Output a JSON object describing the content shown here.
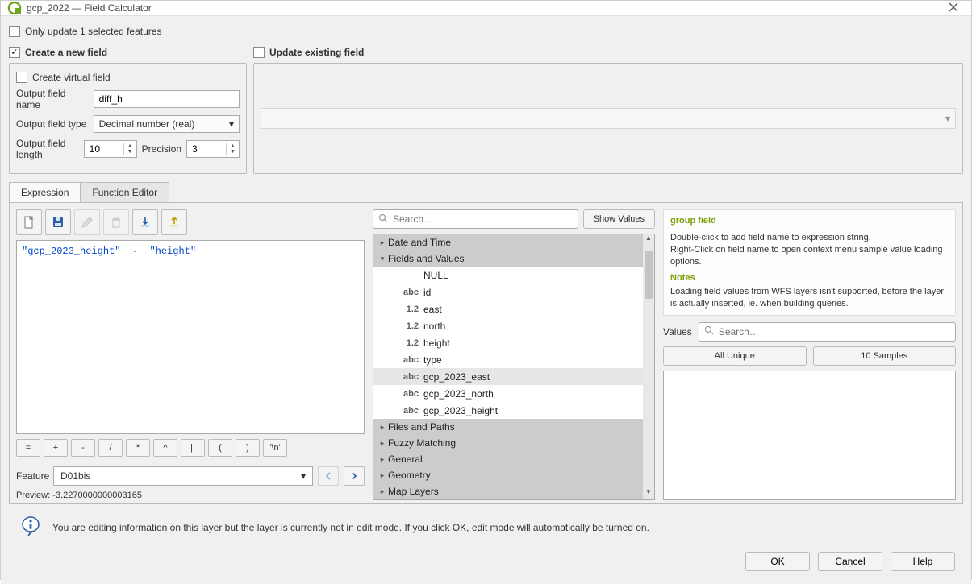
{
  "window": {
    "title": "gcp_2022 — Field Calculator"
  },
  "top": {
    "only_update_label": "Only update 1 selected features",
    "create_new_label": "Create a new field",
    "update_existing_label": "Update existing field"
  },
  "newfield": {
    "virtual_label": "Create virtual field",
    "name_label": "Output field name",
    "name_value": "diff_h",
    "type_label": "Output field type",
    "type_value": "Decimal number (real)",
    "length_label": "Output field length",
    "length_value": "10",
    "precision_label": "Precision",
    "precision_value": "3"
  },
  "tabs": {
    "expression": "Expression",
    "function_editor": "Function Editor"
  },
  "editor": {
    "token_left": "\"gcp_2023_height\"",
    "token_op": "  -  ",
    "token_right": "\"height\""
  },
  "operators": [
    "=",
    "+",
    "-",
    "/",
    "*",
    "^",
    "||",
    "(",
    ")",
    "'\\n'"
  ],
  "feature": {
    "label": "Feature",
    "value": "D01bis",
    "preview_label": "Preview:",
    "preview_value": "-3.2270000000003165"
  },
  "search": {
    "placeholder": "Search…"
  },
  "show_values_btn": "Show Values",
  "tree": {
    "groups_before": [
      "Date and Time"
    ],
    "fields_group": "Fields and Values",
    "fields": [
      {
        "type": "",
        "name": "NULL"
      },
      {
        "type": "abc",
        "name": "id"
      },
      {
        "type": "1.2",
        "name": "east"
      },
      {
        "type": "1.2",
        "name": "north"
      },
      {
        "type": "1.2",
        "name": "height"
      },
      {
        "type": "abc",
        "name": "type"
      },
      {
        "type": "abc",
        "name": "gcp_2023_east"
      },
      {
        "type": "abc",
        "name": "gcp_2023_north"
      },
      {
        "type": "abc",
        "name": "gcp_2023_height"
      }
    ],
    "groups_after": [
      "Files and Paths",
      "Fuzzy Matching",
      "General",
      "Geometry",
      "Map Layers"
    ]
  },
  "help": {
    "title": "group field",
    "body1": "Double-click to add field name to expression string.",
    "body2": "Right-Click on field name to open context menu sample value loading options.",
    "notes_label": "Notes",
    "notes_body": "Loading field values from WFS layers isn't supported, before the layer is actually inserted, ie. when building queries."
  },
  "values": {
    "label": "Values",
    "search_placeholder": "Search…",
    "all_unique": "All Unique",
    "ten_samples": "10 Samples"
  },
  "footer": {
    "note": "You are editing information on this layer but the layer is currently not in edit mode. If you click OK, edit mode will automatically be turned on.",
    "ok": "OK",
    "cancel": "Cancel",
    "help": "Help"
  }
}
